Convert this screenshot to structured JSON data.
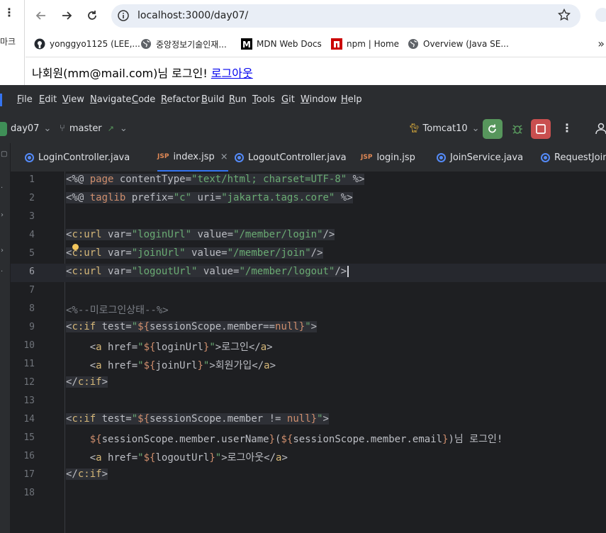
{
  "browser": {
    "left_label": "마크",
    "url": "localhost:3000/day07/",
    "bookmarks": [
      {
        "label": "yonggyo1125 (LEE,...",
        "icon": "github-icon"
      },
      {
        "label": "중앙정보기술인재...",
        "icon": "globe-icon"
      },
      {
        "label": "MDN Web Docs",
        "icon": "mdn-icon"
      },
      {
        "label": "npm | Home",
        "icon": "npm-icon"
      },
      {
        "label": "Overview (Java SE...",
        "icon": "globe-icon"
      }
    ],
    "page_text": "나회원(mm@mail.com)님 로그인! ",
    "logout_link": "로그아웃"
  },
  "ide": {
    "menu": [
      "File",
      "Edit",
      "View",
      "Navigate",
      "Code",
      "Refactor",
      "Build",
      "Run",
      "Tools",
      "Git",
      "Window",
      "Help"
    ],
    "project": "day07",
    "branch": "master",
    "run_config": "Tomcat10",
    "tabs": [
      {
        "label": "LoginController.java",
        "type": "java"
      },
      {
        "label": "index.jsp",
        "type": "jsp",
        "active": true
      },
      {
        "label": "LogoutController.java",
        "type": "java"
      },
      {
        "label": "login.jsp",
        "type": "jsp"
      },
      {
        "label": "JoinService.java",
        "type": "java"
      },
      {
        "label": "RequestJoin",
        "type": "java"
      }
    ],
    "line_numbers": [
      "1",
      "2",
      "3",
      "4",
      "5",
      "6",
      "7",
      "8",
      "9",
      "10",
      "11",
      "12",
      "13",
      "14",
      "15",
      "16",
      "17",
      "18"
    ],
    "current_line": "6",
    "code": {
      "l1": {
        "p1": "<%@ ",
        "k1": "page ",
        "a1": "contentType=",
        "s1": "\"text/html; charset=UTF-8\"",
        "p2": " %>"
      },
      "l2": {
        "p1": "<%@ ",
        "k1": "taglib ",
        "a1": "prefix=",
        "s1": "\"c\"",
        "a2": " uri=",
        "s2": "\"jakarta.tags.core\"",
        "p2": " %>"
      },
      "l4": {
        "p1": "<",
        "t1": "c:url",
        "a1": " var=",
        "s1": "\"loginUrl\"",
        "a2": " value=",
        "s2": "\"/member/login\"",
        "p2": "/>"
      },
      "l5": {
        "p1": "<",
        "t1": "c:url",
        "a1": " var=",
        "s1": "\"joinUrl\"",
        "a2": " value=",
        "s2": "\"/member/join\"",
        "p2": "/>"
      },
      "l6": {
        "p1": "<",
        "t1": "c:url",
        "a1": " var=",
        "s1": "\"logoutUrl\"",
        "a2": " value=",
        "s2": "\"/member/logout\"",
        "p2": "/>"
      },
      "l8": {
        "c1": "<%--미로그인상태--%>"
      },
      "l9": {
        "p1": "<",
        "t1": "c:if",
        "a1": " test=",
        "s1": "\"",
        "e1": "${",
        "e2": "sessionScope.member==",
        "k1": "null",
        "e3": "}",
        "s2": "\"",
        "p2": ">"
      },
      "l10": {
        "p1": "    <",
        "t1": "a",
        "a1": " href=",
        "s1": "\"",
        "e1": "${",
        "e2": "loginUrl",
        "e3": "}",
        "s2": "\"",
        "p2": ">로그인</",
        "t2": "a",
        "p3": ">"
      },
      "l11": {
        "p1": "    <",
        "t1": "a",
        "a1": " href=",
        "s1": "\"",
        "e1": "${",
        "e2": "joinUrl",
        "e3": "}",
        "s2": "\"",
        "p2": ">회원가입</",
        "t2": "a",
        "p3": ">"
      },
      "l12": {
        "p1": "</",
        "t1": "c:if",
        "p2": ">"
      },
      "l14": {
        "p1": "<",
        "t1": "c:if",
        "a1": " test=",
        "s1": "\"",
        "e1": "${",
        "e2": "sessionScope.member != ",
        "k1": "null",
        "e3": "}",
        "s2": "\"",
        "p2": ">"
      },
      "l15": {
        "p1": "    ",
        "e1": "${",
        "e2": "sessionScope.member.userName",
        "e3": "}",
        "p2": "(",
        "e4": "${",
        "e5": "sessionScope.member.email",
        "e6": "}",
        "p3": ")님 로그인!"
      },
      "l16": {
        "p1": "    <",
        "t1": "a",
        "a1": " href=",
        "s1": "\"",
        "e1": "${",
        "e2": "logoutUrl",
        "e3": "}",
        "s2": "\"",
        "p2": ">로그아웃</",
        "t2": "a",
        "p3": ">"
      },
      "l17": {
        "p1": "</",
        "t1": "c:if",
        "p2": ">"
      }
    }
  },
  "colors": {
    "accent": "#3574f0",
    "run": "#57965c",
    "stop": "#c94f4f",
    "keyword": "#cf8e6d",
    "string": "#6aab73",
    "tag": "#d5b778"
  }
}
